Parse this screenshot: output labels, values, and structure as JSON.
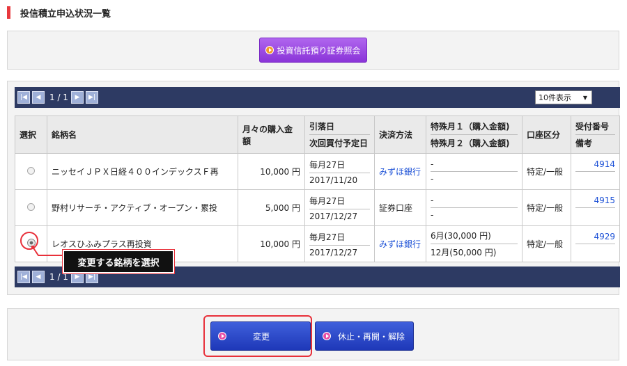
{
  "page_title": "投信積立申込状況一覧",
  "inquiry_button": "投資信託預り証券照会",
  "pagination": {
    "text": "1 / 1",
    "first": "|◀",
    "prev": "◀",
    "next": "▶",
    "last": "▶|"
  },
  "per_page_select": "10件表示",
  "table": {
    "headers": {
      "select": "選択",
      "name": "銘柄名",
      "monthly": "月々の購入金額",
      "debit_day": "引落日",
      "next_buy": "次回買付予定日",
      "payment": "決済方法",
      "special1": "特殊月１（購入金額)",
      "special2": "特殊月２（購入金額)",
      "account": "口座区分",
      "receipt": "受付番号",
      "remarks": "備考"
    },
    "rows": [
      {
        "name": "ニッセイＪＰＸ日経４００インデックスＦ再",
        "amount": "10,000 円",
        "day": "毎月27日",
        "next": "2017/11/20",
        "payment": "みずほ銀行",
        "payment_link": true,
        "sp1": "-",
        "sp2": "-",
        "account": "特定/一般",
        "receipt": "4914",
        "selected": false
      },
      {
        "name": "野村リサーチ・アクティブ・オープン・累投",
        "amount": "5,000 円",
        "day": "毎月27日",
        "next": "2017/12/27",
        "payment": "証券口座",
        "payment_link": false,
        "sp1": "-",
        "sp2": "-",
        "account": "特定/一般",
        "receipt": "4915",
        "selected": false
      },
      {
        "name": "レオスひふみプラス再投資",
        "amount": "10,000 円",
        "day": "毎月27日",
        "next": "2017/12/27",
        "payment": "みずほ銀行",
        "payment_link": true,
        "sp1": "6月(30,000 円)",
        "sp2": "12月(50,000 円)",
        "account": "特定/一般",
        "receipt": "4929",
        "selected": true
      }
    ]
  },
  "callout": "変更する銘柄を選択",
  "buttons": {
    "change": "変更",
    "suspend": "休止・再開・解除"
  },
  "colors": {
    "navbar": "#2d3a63",
    "purple": "#9b4de3",
    "blue": "#2a46c8",
    "highlight": "#e8303a"
  }
}
